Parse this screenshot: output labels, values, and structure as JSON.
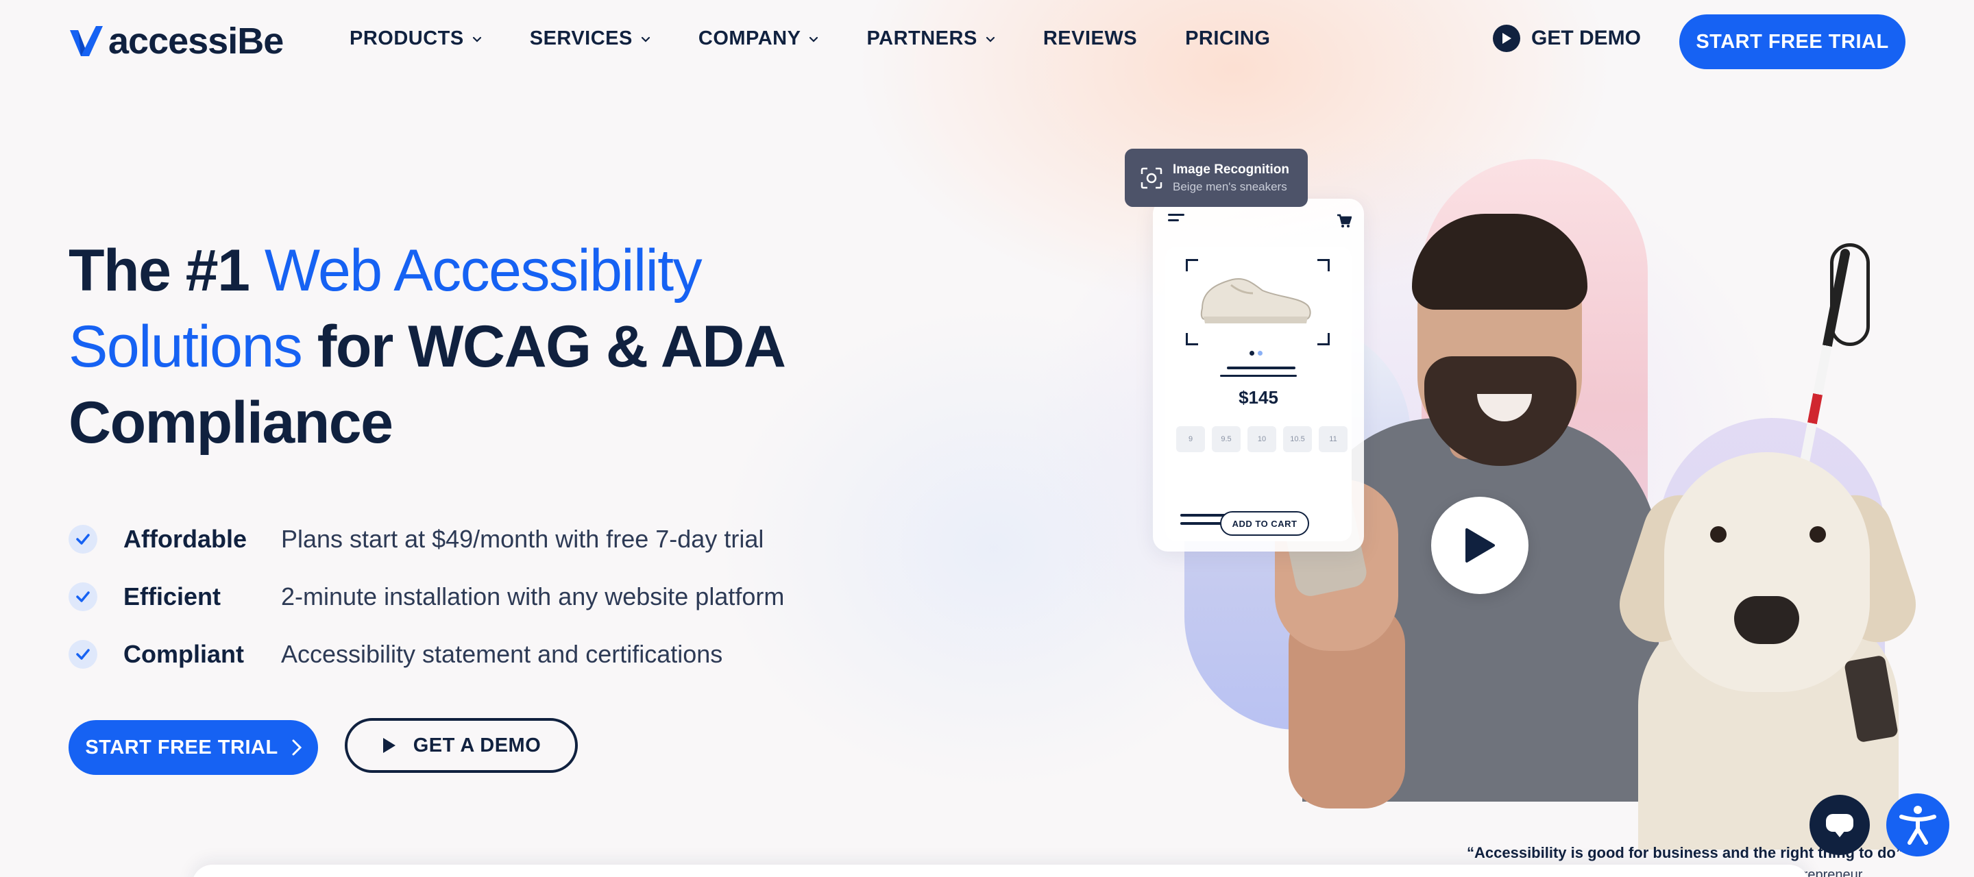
{
  "brand": {
    "name": "accessiBe",
    "accent": "#1662f3",
    "dark": "#10213f"
  },
  "nav": {
    "items": [
      {
        "label": "PRODUCTS",
        "dropdown": true
      },
      {
        "label": "SERVICES",
        "dropdown": true
      },
      {
        "label": "COMPANY",
        "dropdown": true
      },
      {
        "label": "PARTNERS",
        "dropdown": true
      },
      {
        "label": "REVIEWS",
        "dropdown": false
      },
      {
        "label": "PRICING",
        "dropdown": false
      }
    ],
    "get_demo": "GET DEMO",
    "start_trial": "START FREE TRIAL"
  },
  "hero": {
    "title_part1": "The #1 ",
    "title_highlight": "Web Accessibility Solutions",
    "title_part2": " for WCAG & ADA Compliance",
    "features": [
      {
        "name": "Affordable",
        "desc": "Plans start at $49/month with free 7-day trial"
      },
      {
        "name": "Efficient",
        "desc": "2-minute installation with any website platform"
      },
      {
        "name": "Compliant",
        "desc": "Accessibility statement and certifications"
      }
    ],
    "cta_primary": "START FREE TRIAL",
    "cta_secondary": "GET A DEMO"
  },
  "visual": {
    "image_recognition": {
      "title": "Image Recognition",
      "caption": "Beige men's sneakers"
    },
    "product": {
      "price": "$145",
      "sizes": [
        "9",
        "9.5",
        "10",
        "10.5",
        "11"
      ],
      "add_to_cart": "ADD TO CART"
    }
  },
  "quote": {
    "text": "“Accessibility is good for business and the right thing to do”",
    "attribution": "Ben, blind user & entrepreneur"
  },
  "icons": {
    "logo": "accessibe-check-logo",
    "play": "play-icon",
    "chat": "chat-icon",
    "accessibility": "accessibility-person-icon"
  }
}
